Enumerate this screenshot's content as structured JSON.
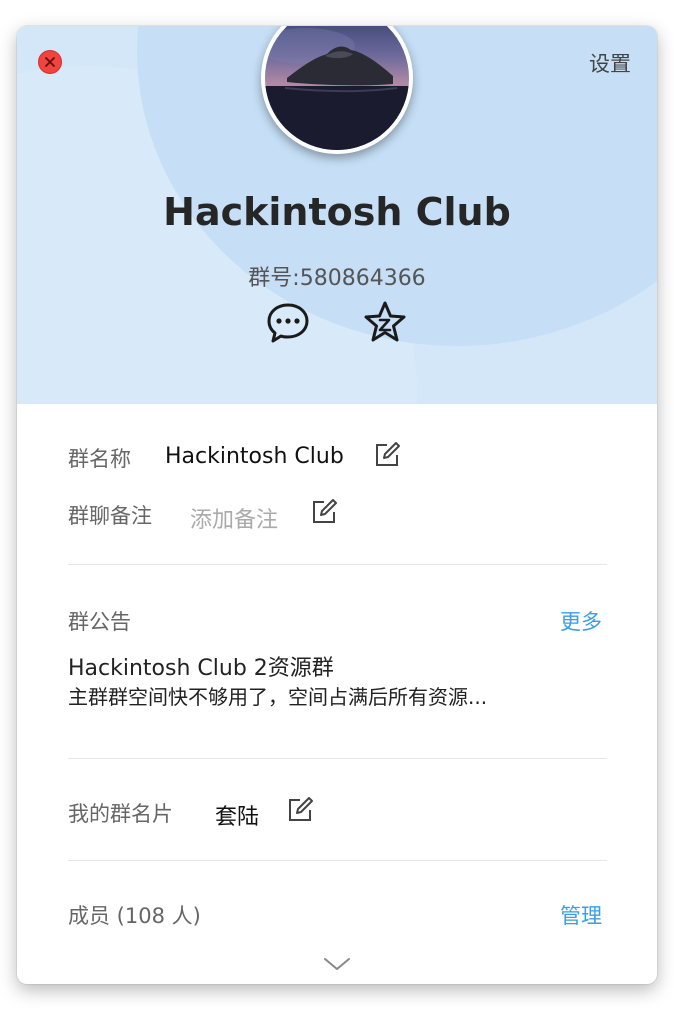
{
  "header": {
    "settings_label": "设置",
    "group_title": "Hackintosh Club",
    "group_number": "群号:580864366"
  },
  "info": {
    "group_name_label": "群名称",
    "group_name_value": "Hackintosh Club",
    "group_remark_label": "群聊备注",
    "group_remark_placeholder": "添加备注"
  },
  "notice": {
    "label": "群公告",
    "more_label": "更多",
    "title": "Hackintosh Club 2资源群",
    "body": "主群群空间快不够用了，空间占满后所有资源..."
  },
  "card": {
    "label": "我的群名片",
    "value": "套陆"
  },
  "members": {
    "label": "成员 (108 人)",
    "manage_label": "管理"
  },
  "colors": {
    "accent": "#3a9ee8",
    "header_bg": "#d3e7f8",
    "close_red": "#f0443e"
  },
  "icons": [
    "close-icon",
    "chat-bubble-icon",
    "star-icon",
    "edit-icon",
    "chevron-down-icon"
  ]
}
